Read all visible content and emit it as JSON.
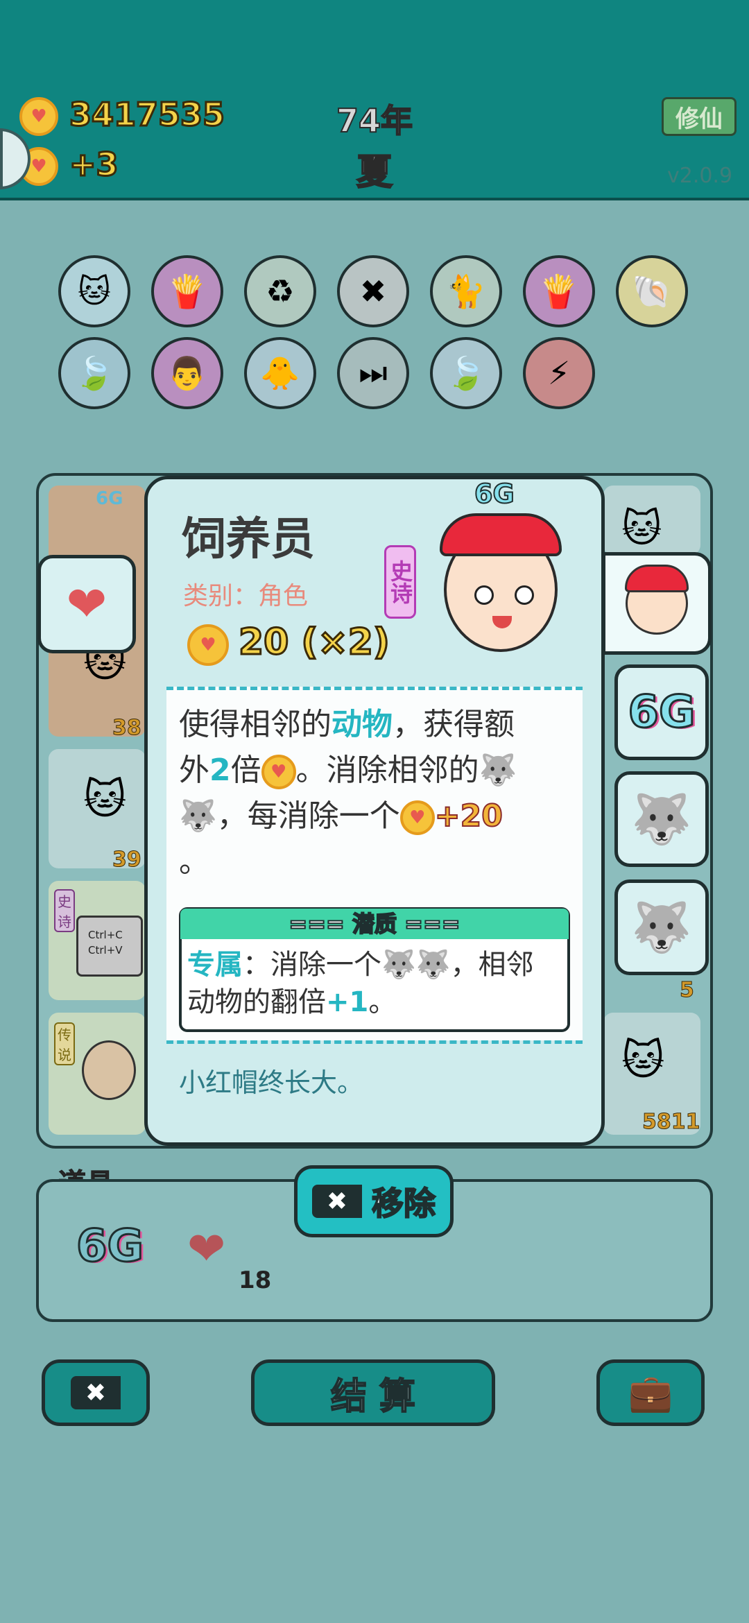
{
  "header": {
    "coins": "3417535",
    "coin_delta": "+3",
    "year": "74年",
    "season": "夏",
    "cultivate_button": "修仙",
    "version": "v2.0.9"
  },
  "board": {
    "numbers": [
      "38",
      "39",
      "5",
      "5811"
    ],
    "left_card_labels": [
      "史诗",
      "传说"
    ],
    "ctrl_keys": "Ctrl+C\nCtrl+V",
    "sixg_small": "6G"
  },
  "popup": {
    "title": "饲养员",
    "badge_top": "6G",
    "category": "类别：角色",
    "rarity": "史诗",
    "value": "20 (×2)",
    "description": {
      "line1_a": "使得相邻的",
      "line1_hl": "动物",
      "line1_b": "，获得额",
      "line2_a": "外",
      "line2_hl": "2",
      "line2_b": "倍",
      "line2_c": "。消除相邻的",
      "line3_a": "，每消除一个",
      "line3_plus": "+20",
      "line4": "。"
    },
    "potential_title": "=== 潜质 ===",
    "potential_text": {
      "hl": "专属",
      "a": "：消除一个",
      "b": "，相邻",
      "c": "动物的翻倍",
      "hl2": "+1",
      "d": "。"
    },
    "flavor": "小红帽终长大。"
  },
  "items": {
    "label": "道具",
    "remove_button": "移除",
    "sixg": "6G",
    "liver_count": "18"
  },
  "bottom": {
    "settle_button": "结 算"
  },
  "colors": {
    "header": "#0f8580",
    "accent": "#25b6c2",
    "coin": "#f6c33a",
    "popup_bg": "#cfeced"
  }
}
